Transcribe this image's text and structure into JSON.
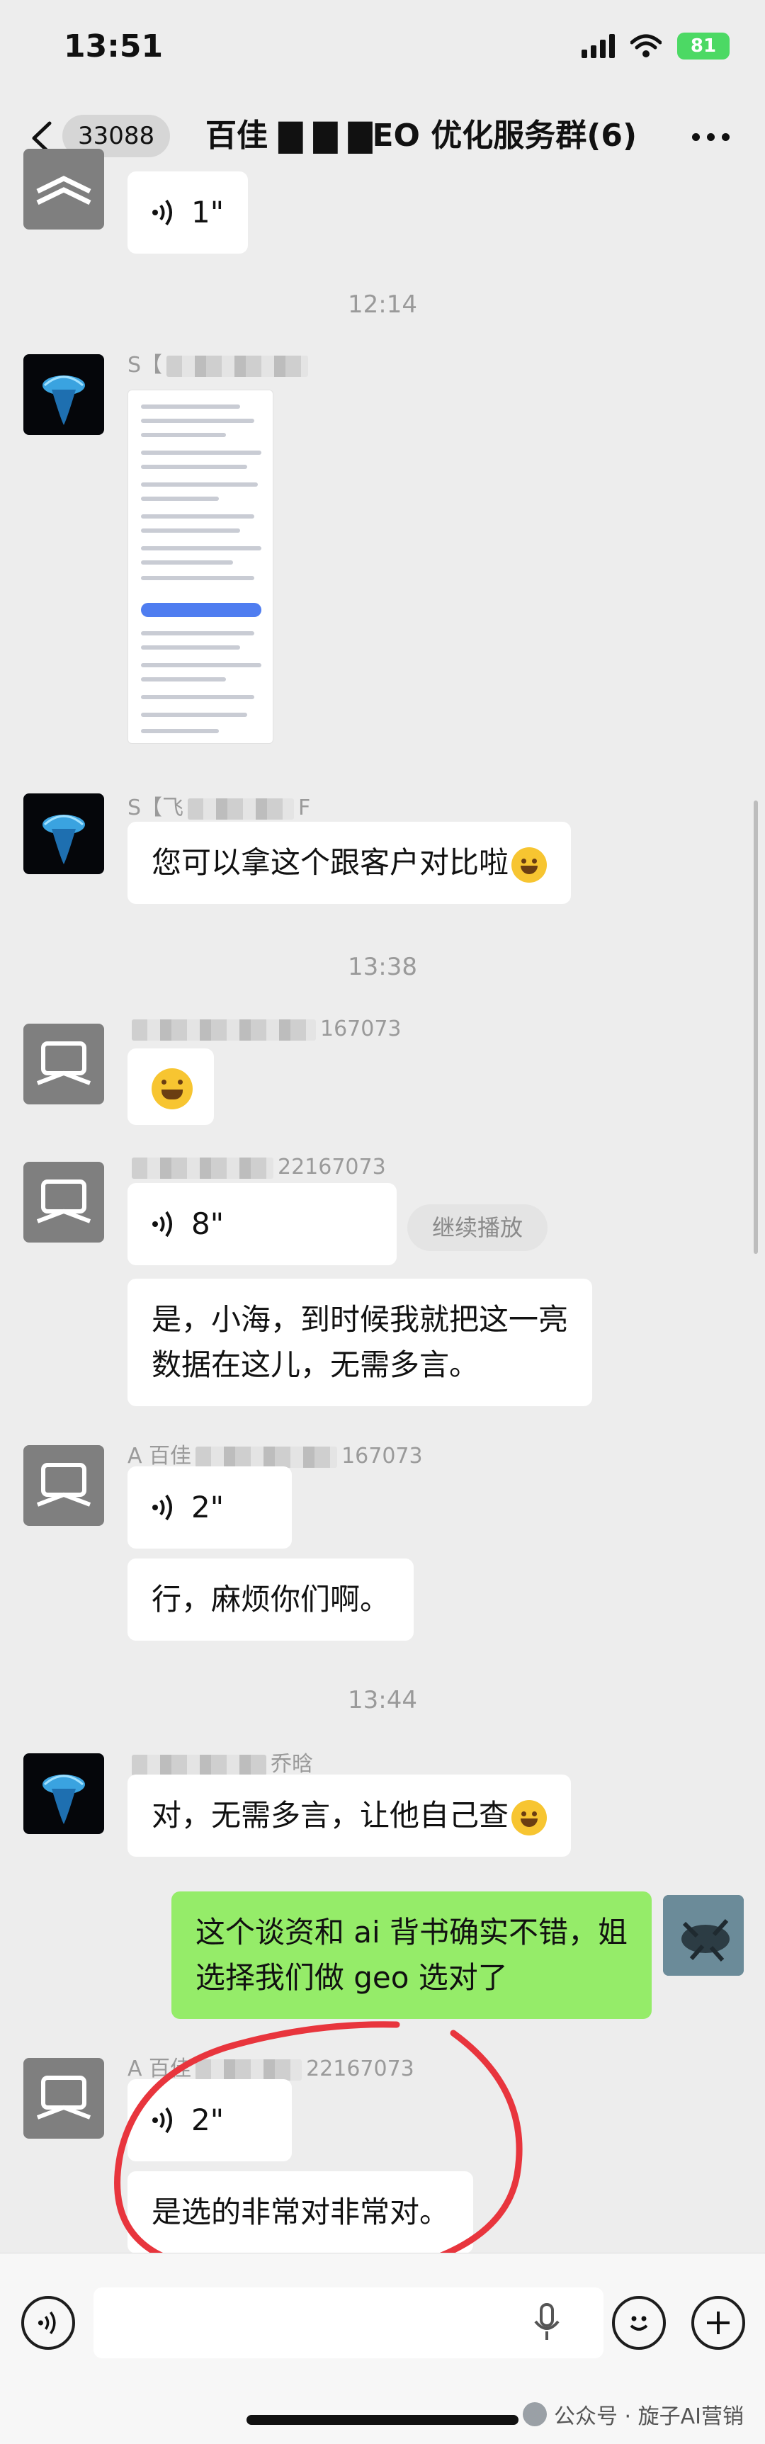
{
  "status_bar": {
    "time": "13:51",
    "battery": "81"
  },
  "nav": {
    "unread_count": "33088",
    "title": "百佳 ▇ ▇ ▇EO 优化服务群(6)"
  },
  "messages": {
    "voice_1": {
      "duration": "1\""
    },
    "ts_1": "12:14",
    "s_msg1": {
      "sender_prefix": "S【"
    },
    "s_msg2": {
      "sender_prefix": "S【飞",
      "sender_suffix": "F",
      "text": "您可以拿这个跟客户对比啦"
    },
    "ts_2": "13:38",
    "a_msg1": {
      "sender_suffix": "167073"
    },
    "a_msg2": {
      "sender_suffix": "22167073",
      "voice_duration": "8\"",
      "continue_label": "继续播放",
      "text_line1": "是，小海，到时候我就把这一亮",
      "text_line2": "数据在这儿，无需多言。"
    },
    "a_msg3": {
      "sender_prefix": "A 百佳",
      "sender_suffix": "167073",
      "voice_duration": "2\"",
      "text": "行，麻烦你们啊。"
    },
    "ts_3": "13:44",
    "c_msg": {
      "sender_suffix": "乔晗",
      "text": "对，无需多言，让他自己查"
    },
    "me_msg": {
      "text_line1": "这个谈资和 ai 背书确实不错，姐",
      "text_line2": "选择我们做 geo 选对了"
    },
    "a_msg4": {
      "sender_prefix": "A 百佳",
      "sender_suffix": "22167073",
      "voice_duration": "2\"",
      "text": "是选的非常对非常对。"
    }
  },
  "watermark": {
    "text": "公众号 · 旋子AI营销"
  },
  "colors": {
    "bg": "#ededed",
    "bubble_self": "#95ec69",
    "bubble_other": "#ffffff",
    "annotation": "#e8353d"
  }
}
